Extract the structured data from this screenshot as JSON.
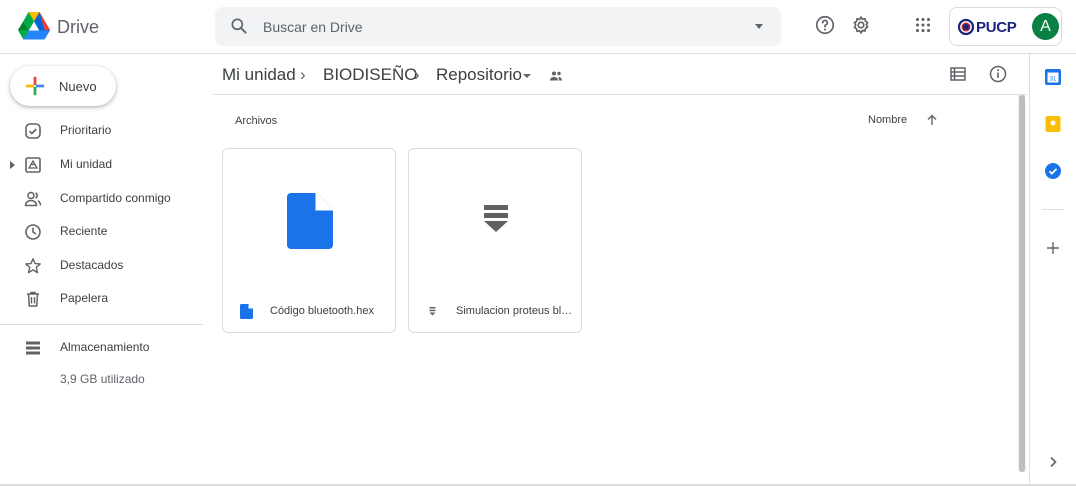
{
  "header": {
    "app_name": "Drive",
    "search_placeholder": "Buscar en Drive",
    "org_name": "PUCP",
    "avatar_initial": "A"
  },
  "sidebar": {
    "new_label": "Nuevo",
    "items": [
      {
        "label": "Prioritario",
        "icon": "priority-icon"
      },
      {
        "label": "Mi unidad",
        "icon": "my-drive-icon"
      },
      {
        "label": "Compartido conmigo",
        "icon": "shared-with-me-icon"
      },
      {
        "label": "Reciente",
        "icon": "clock-icon"
      },
      {
        "label": "Destacados",
        "icon": "star-icon"
      },
      {
        "label": "Papelera",
        "icon": "trash-icon"
      }
    ],
    "storage": {
      "label": "Almacenamiento",
      "used": "3,9 GB utilizado"
    }
  },
  "breadcrumb": [
    "Mi unidad",
    "BIODISEÑO",
    "Repositorio"
  ],
  "content": {
    "section_title": "Archivos",
    "sort_label": "Nombre",
    "files": [
      {
        "name": "Código bluetooth.hex",
        "icon": "doc-icon"
      },
      {
        "name": "Simulacion proteus bluetooth",
        "icon": "proteus-icon"
      }
    ]
  },
  "colors": {
    "accent_blue": "#1a73e8",
    "doc_blue": "#2684fc",
    "avatar_green": "#0b8043",
    "keep_yellow": "#fbbc04"
  }
}
